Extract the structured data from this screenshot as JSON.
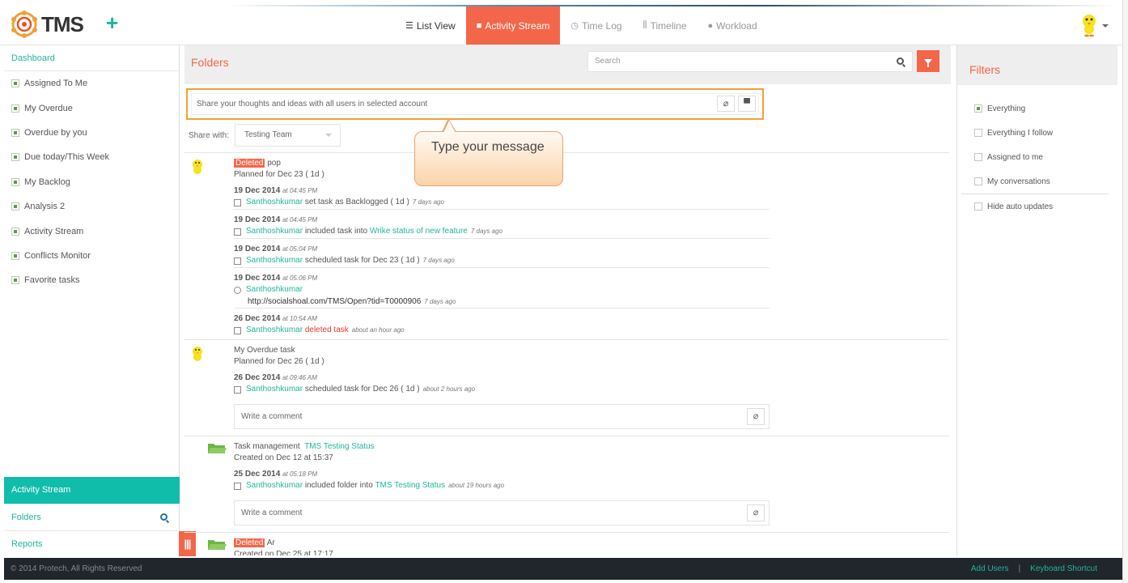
{
  "app": {
    "name": "TMS"
  },
  "nav": {
    "items": [
      {
        "label": "List View",
        "icon": "list-icon"
      },
      {
        "label": "Activity Stream",
        "icon": "comment-icon",
        "active": true
      },
      {
        "label": "Time Log",
        "icon": "clock-icon"
      },
      {
        "label": "Timeline",
        "icon": "sliders-icon"
      },
      {
        "label": "Workload",
        "icon": "user-icon"
      }
    ]
  },
  "sidebar": {
    "dashboard": "Dashboard",
    "items": [
      {
        "label": "Assigned To Me"
      },
      {
        "label": "My Overdue"
      },
      {
        "label": "Overdue by you"
      },
      {
        "label": "Due today/This Week"
      },
      {
        "label": "My Backlog"
      },
      {
        "label": "Analysis 2"
      },
      {
        "label": "Activity Stream"
      },
      {
        "label": "Conflicts Monitor"
      },
      {
        "label": "Favorite tasks"
      }
    ],
    "bottom": {
      "activity": "Activity Stream",
      "folders": "Folders",
      "reports": "Reports"
    }
  },
  "main": {
    "title": "Folders",
    "search_placeholder": "Search",
    "message_placeholder": "Share your thoughts and ideas with all users in selected account",
    "share_label": "Share with:",
    "share_value": "Testing Team",
    "callout": "Type your message",
    "comment_placeholder": "Write a comment"
  },
  "feed": {
    "e1": {
      "badge": "Deleted",
      "title": "pop",
      "planned": "Planned for Dec 23 ( 1d )",
      "a1": {
        "date": "19 Dec 2014",
        "time": "at 04:45 PM",
        "user": "Santhoshkumar",
        "text": "set task as Backlogged ( 1d )",
        "ago": "7 days ago"
      },
      "a2": {
        "date": "19 Dec 2014",
        "time": "at 04:45 PM",
        "user": "Santhoshkumar",
        "text": "included task into",
        "link": "Wrike status of new feature",
        "ago": "7 days ago"
      },
      "a3": {
        "date": "19 Dec 2014",
        "time": "at 05:04 PM",
        "user": "Santhoshkumar",
        "text": "scheduled task for Dec 23 ( 1d )",
        "ago": "7 days ago"
      },
      "a4": {
        "date": "19 Dec 2014",
        "time": "at 05:06 PM",
        "user": "Santhoshkumar",
        "url": "http://socialshoal.com/TMS/Open?tid=T0000906",
        "ago": "7 days ago"
      },
      "a5": {
        "date": "26 Dec 2014",
        "time": "at 10:54 AM",
        "user": "Santhoshkumar",
        "text": "deleted task",
        "ago": "about an hour ago"
      }
    },
    "e2": {
      "title": "My Overdue task",
      "planned": "Planned for Dec 26 ( 1d )",
      "a1": {
        "date": "26 Dec 2014",
        "time": "at 09:46 AM",
        "user": "Santhoshkumar",
        "text": "scheduled task for Dec 26 ( 1d )",
        "ago": "about 2 hours ago"
      }
    },
    "e3": {
      "title": "Task management",
      "link": "TMS Testing Status",
      "created": "Created on Dec 12 at 15:37",
      "a1": {
        "date": "25 Dec 2014",
        "time": "at 05:18 PM",
        "user": "Santhoshkumar",
        "text": "included folder into",
        "link": "TMS Testing Status",
        "ago": "about 19 hours ago"
      }
    },
    "e4": {
      "badge": "Deleted",
      "title": "Ar",
      "created": "Created on Dec 25 at 17:17"
    }
  },
  "filters": {
    "title": "Filters",
    "items": [
      {
        "label": "Everything",
        "checked": true
      },
      {
        "label": "Everything I follow",
        "checked": false
      },
      {
        "label": "Assigned to me",
        "checked": false
      },
      {
        "label": "My conversations",
        "checked": false
      }
    ],
    "hide_auto": "Hide auto updates"
  },
  "footer": {
    "copyright": "© 2014 Protech, All Rights Reserved",
    "add_users": "Add Users",
    "sep": "|",
    "shortcut": "Keyboard Shortcut"
  },
  "colors": {
    "accent": "#f4664a",
    "teal": "#1fb59c",
    "footer": "#20262b"
  }
}
